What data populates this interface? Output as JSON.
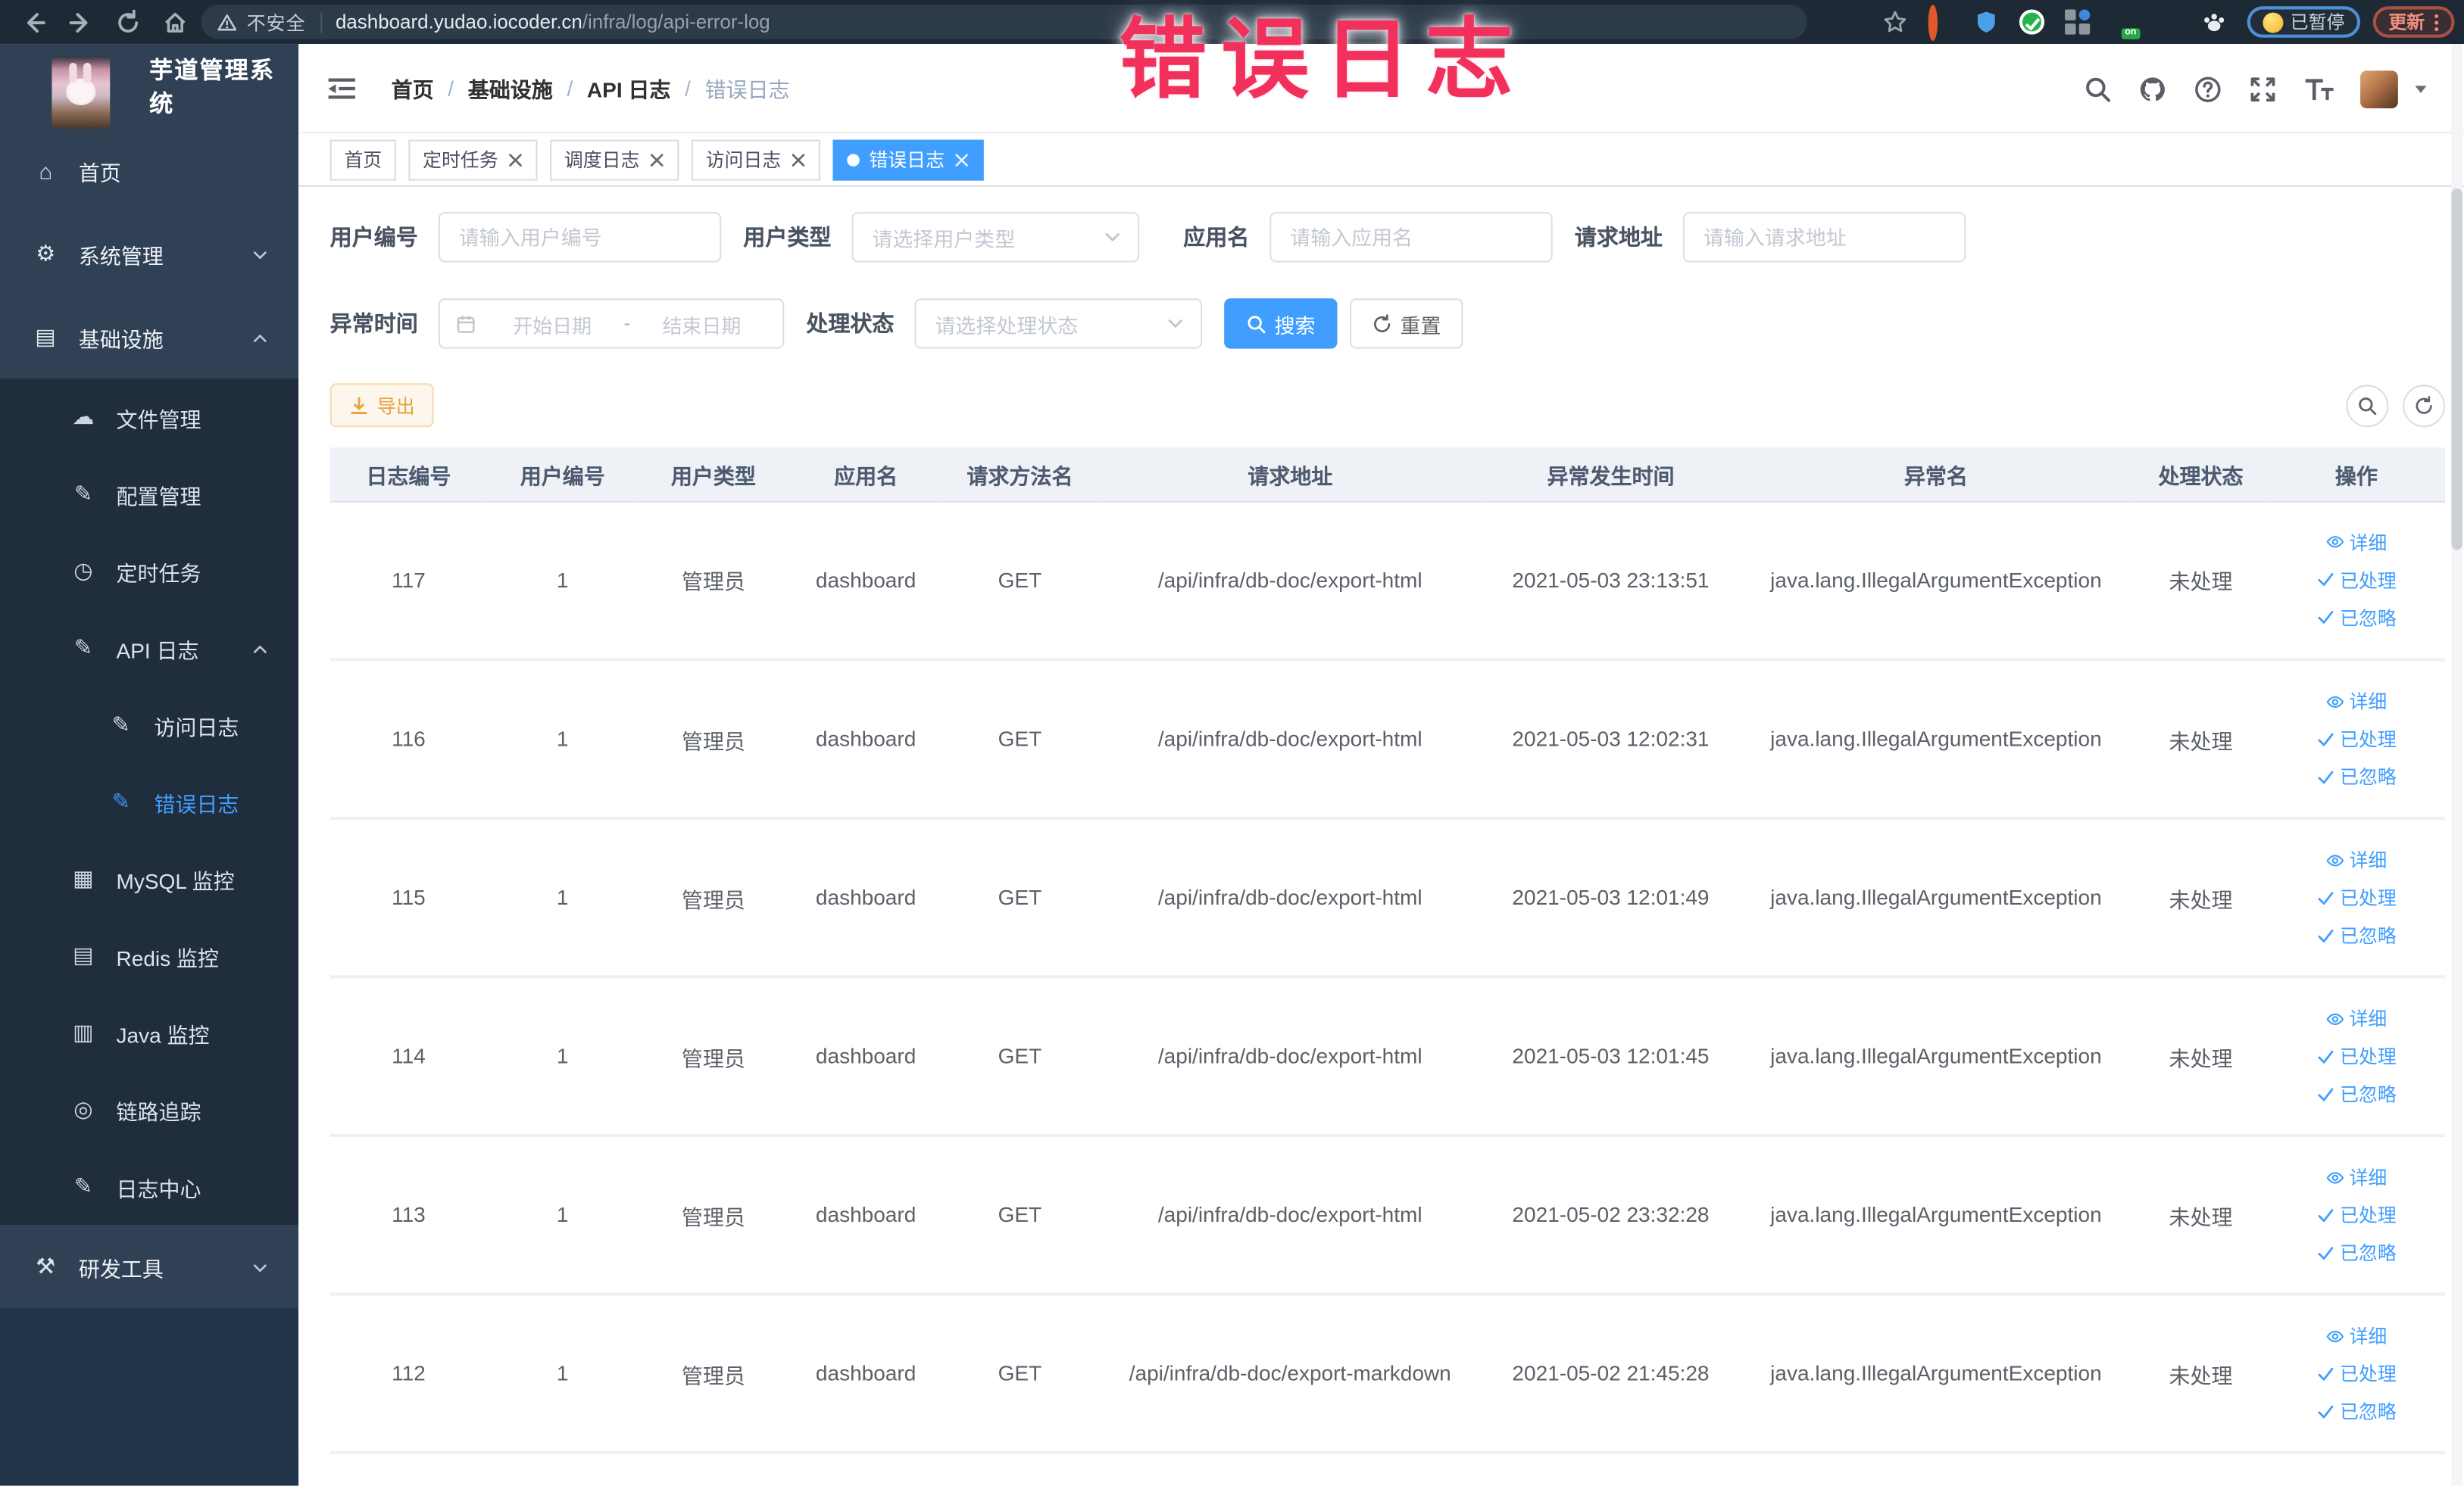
{
  "browser": {
    "security_label": "不安全",
    "url_domain": "dashboard.yudao.iocoder.cn",
    "url_path": "/infra/log/api-error-log",
    "paused_pill": "已暂停",
    "update_button": "更新"
  },
  "annotation": {
    "text": "错误日志",
    "color": "#f2305c"
  },
  "sidebar": {
    "title": "芋道管理系统",
    "menu": [
      {
        "name": "sidebar-item-home",
        "label": "首页",
        "glyph": "⌂",
        "icon": "home-icon",
        "cls": "lvl1",
        "chev_down": false,
        "chev_up": false
      },
      {
        "name": "sidebar-item-system-management",
        "label": "系统管理",
        "glyph": "⚙",
        "icon": "gear-icon",
        "cls": "lvl1",
        "chev_down": true,
        "chev_up": false
      },
      {
        "name": "sidebar-item-infrastructure",
        "label": "基础设施",
        "glyph": "▤",
        "icon": "infrastructure-icon",
        "cls": "lvl1",
        "chev_down": false,
        "chev_up": true
      },
      {
        "name": "sidebar-item-file-management",
        "label": "文件管理",
        "glyph": "☁",
        "icon": "file-upload-icon",
        "cls": "lvl2 sub",
        "chev_down": false,
        "chev_up": false
      },
      {
        "name": "sidebar-item-config-management",
        "label": "配置管理",
        "glyph": "✎",
        "icon": "edit-icon",
        "cls": "lvl2 sub",
        "chev_down": false,
        "chev_up": false
      },
      {
        "name": "sidebar-item-scheduled-tasks",
        "label": "定时任务",
        "glyph": "◷",
        "icon": "timer-icon",
        "cls": "lvl2 sub",
        "chev_down": false,
        "chev_up": false
      },
      {
        "name": "sidebar-item-api-log",
        "label": "API 日志",
        "glyph": "✎",
        "icon": "api-log-icon",
        "cls": "lvl2 sub",
        "chev_down": false,
        "chev_up": true
      },
      {
        "name": "sidebar-item-access-log",
        "label": "访问日志",
        "glyph": "✎",
        "icon": "access-log-icon",
        "cls": "lvl3 sub",
        "chev_down": false,
        "chev_up": false
      },
      {
        "name": "sidebar-item-error-log",
        "label": "错误日志",
        "glyph": "✎",
        "icon": "error-log-icon",
        "cls": "lvl3 sub active",
        "chev_down": false,
        "chev_up": false
      },
      {
        "name": "sidebar-item-mysql-monitor",
        "label": "MySQL 监控",
        "glyph": "▦",
        "icon": "mysql-monitor-icon",
        "cls": "lvl2 sub",
        "chev_down": false,
        "chev_up": false
      },
      {
        "name": "sidebar-item-redis-monitor",
        "label": "Redis 监控",
        "glyph": "▤",
        "icon": "redis-monitor-icon",
        "cls": "lvl2 sub",
        "chev_down": false,
        "chev_up": false
      },
      {
        "name": "sidebar-item-java-monitor",
        "label": "Java 监控",
        "glyph": "▥",
        "icon": "java-monitor-icon",
        "cls": "lvl2 sub",
        "chev_down": false,
        "chev_up": false
      },
      {
        "name": "sidebar-item-trace",
        "label": "链路追踪",
        "glyph": "◎",
        "icon": "trace-icon",
        "cls": "lvl2 sub",
        "chev_down": false,
        "chev_up": false
      },
      {
        "name": "sidebar-item-log-center",
        "label": "日志中心",
        "glyph": "✎",
        "icon": "log-center-icon",
        "cls": "lvl2 sub",
        "chev_down": false,
        "chev_up": false
      },
      {
        "name": "sidebar-item-devtools",
        "label": "研发工具",
        "glyph": "⚒",
        "icon": "devtools-icon",
        "cls": "lvl1",
        "chev_down": true,
        "chev_up": false
      }
    ]
  },
  "breadcrumb": {
    "home": "首页",
    "l1": "基础设施",
    "l2": "API 日志",
    "current": "错误日志",
    "separator": "/"
  },
  "tabs": [
    {
      "name": "tab-home",
      "label": "首页",
      "cls": "",
      "active": false,
      "closable": false
    },
    {
      "name": "tab-scheduled-tasks",
      "label": "定时任务",
      "cls": "",
      "active": false,
      "closable": true
    },
    {
      "name": "tab-schedule-log",
      "label": "调度日志",
      "cls": "",
      "active": false,
      "closable": true
    },
    {
      "name": "tab-access-log",
      "label": "访问日志",
      "cls": "",
      "active": false,
      "closable": true
    },
    {
      "name": "tab-error-log",
      "label": "错误日志",
      "cls": "active",
      "active": true,
      "closable": true
    }
  ],
  "filters": {
    "user_id": {
      "label": "用户编号",
      "placeholder": "请输入用户编号"
    },
    "user_type": {
      "label": "用户类型",
      "placeholder": "请选择用户类型"
    },
    "app_name": {
      "label": "应用名",
      "placeholder": "请输入应用名"
    },
    "request_url": {
      "label": "请求地址",
      "placeholder": "请输入请求地址"
    },
    "error_time": {
      "label": "异常时间",
      "start": "开始日期",
      "separator": "-",
      "end": "结束日期"
    },
    "process_status": {
      "label": "处理状态",
      "placeholder": "请选择处理状态"
    },
    "search_button": "搜索",
    "reset_button": "重置",
    "export_button": "导出"
  },
  "table": {
    "columns": [
      "日志编号",
      "用户编号",
      "用户类型",
      "应用名",
      "请求方法名",
      "请求地址",
      "异常发生时间",
      "异常名",
      "处理状态",
      "操作"
    ],
    "actions": {
      "detail": "详细",
      "process": "已处理",
      "ignore": "已忽略"
    },
    "rows": [
      {
        "log_id": "117",
        "user_id": "1",
        "user_type": "管理员",
        "app_name": "dashboard",
        "method": "GET",
        "url": "/api/infra/db-doc/export-html",
        "time": "2021-05-03 23:13:51",
        "exception": "java.lang.IllegalArgumentException",
        "status": "未处理"
      },
      {
        "log_id": "116",
        "user_id": "1",
        "user_type": "管理员",
        "app_name": "dashboard",
        "method": "GET",
        "url": "/api/infra/db-doc/export-html",
        "time": "2021-05-03 12:02:31",
        "exception": "java.lang.IllegalArgumentException",
        "status": "未处理"
      },
      {
        "log_id": "115",
        "user_id": "1",
        "user_type": "管理员",
        "app_name": "dashboard",
        "method": "GET",
        "url": "/api/infra/db-doc/export-html",
        "time": "2021-05-03 12:01:49",
        "exception": "java.lang.IllegalArgumentException",
        "status": "未处理"
      },
      {
        "log_id": "114",
        "user_id": "1",
        "user_type": "管理员",
        "app_name": "dashboard",
        "method": "GET",
        "url": "/api/infra/db-doc/export-html",
        "time": "2021-05-03 12:01:45",
        "exception": "java.lang.IllegalArgumentException",
        "status": "未处理"
      },
      {
        "log_id": "113",
        "user_id": "1",
        "user_type": "管理员",
        "app_name": "dashboard",
        "method": "GET",
        "url": "/api/infra/db-doc/export-html",
        "time": "2021-05-02 23:32:28",
        "exception": "java.lang.IllegalArgumentException",
        "status": "未处理"
      },
      {
        "log_id": "112",
        "user_id": "1",
        "user_type": "管理员",
        "app_name": "dashboard",
        "method": "GET",
        "url": "/api/infra/db-doc/export-markdown",
        "time": "2021-05-02 21:45:28",
        "exception": "java.lang.IllegalArgumentException",
        "status": "未处理"
      }
    ]
  },
  "colors": {
    "accent": "#409eff",
    "warning": "#e6a23c",
    "sidebar_bg": "#304156",
    "submenu_bg": "#1f2d3d",
    "annotation": "#f2305c"
  }
}
